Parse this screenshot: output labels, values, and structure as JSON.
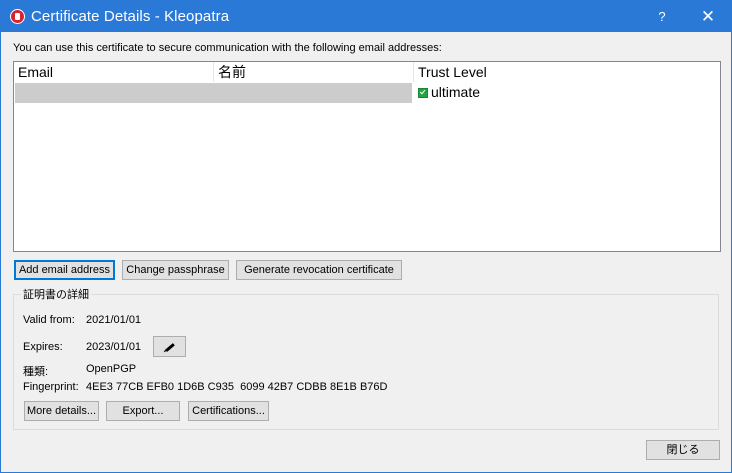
{
  "window": {
    "title": "Certificate Details - Kleopatra",
    "help_label": "?",
    "close_label": "✕"
  },
  "intro_text": "You can use this certificate to secure communication with the following email addresses:",
  "table": {
    "columns": [
      "Email",
      "名前",
      "Trust Level"
    ],
    "rows": [
      {
        "email": "",
        "name": "",
        "trust": "ultimate"
      }
    ]
  },
  "buttons": {
    "add_email": "Add email address",
    "change_passphrase": "Change passphrase",
    "generate_revocation": "Generate revocation certificate"
  },
  "details": {
    "group_title": "証明書の詳細",
    "valid_from_label": "Valid from:",
    "valid_from_value": "2021/01/01",
    "expires_label": "Expires:",
    "expires_value": "2023/01/01",
    "type_label": "種類:",
    "type_value": "OpenPGP",
    "fingerprint_label": "Fingerprint:",
    "fingerprint_value": "4EE3 77CB EFB0 1D6B C935  6099 42B7 CDBB 8E1B B76D",
    "more_details": "More details...",
    "export": "Export...",
    "certifications": "Certifications..."
  },
  "footer": {
    "close_label": "閉じる"
  },
  "colors": {
    "titlebar": "#2b79d7",
    "selection": "#cccccc",
    "focus": "#0078d7",
    "trust_icon": "#22a344"
  },
  "icons": {
    "app": "kleopatra-icon",
    "trust": "checkmark-icon",
    "edit": "pencil-icon"
  }
}
